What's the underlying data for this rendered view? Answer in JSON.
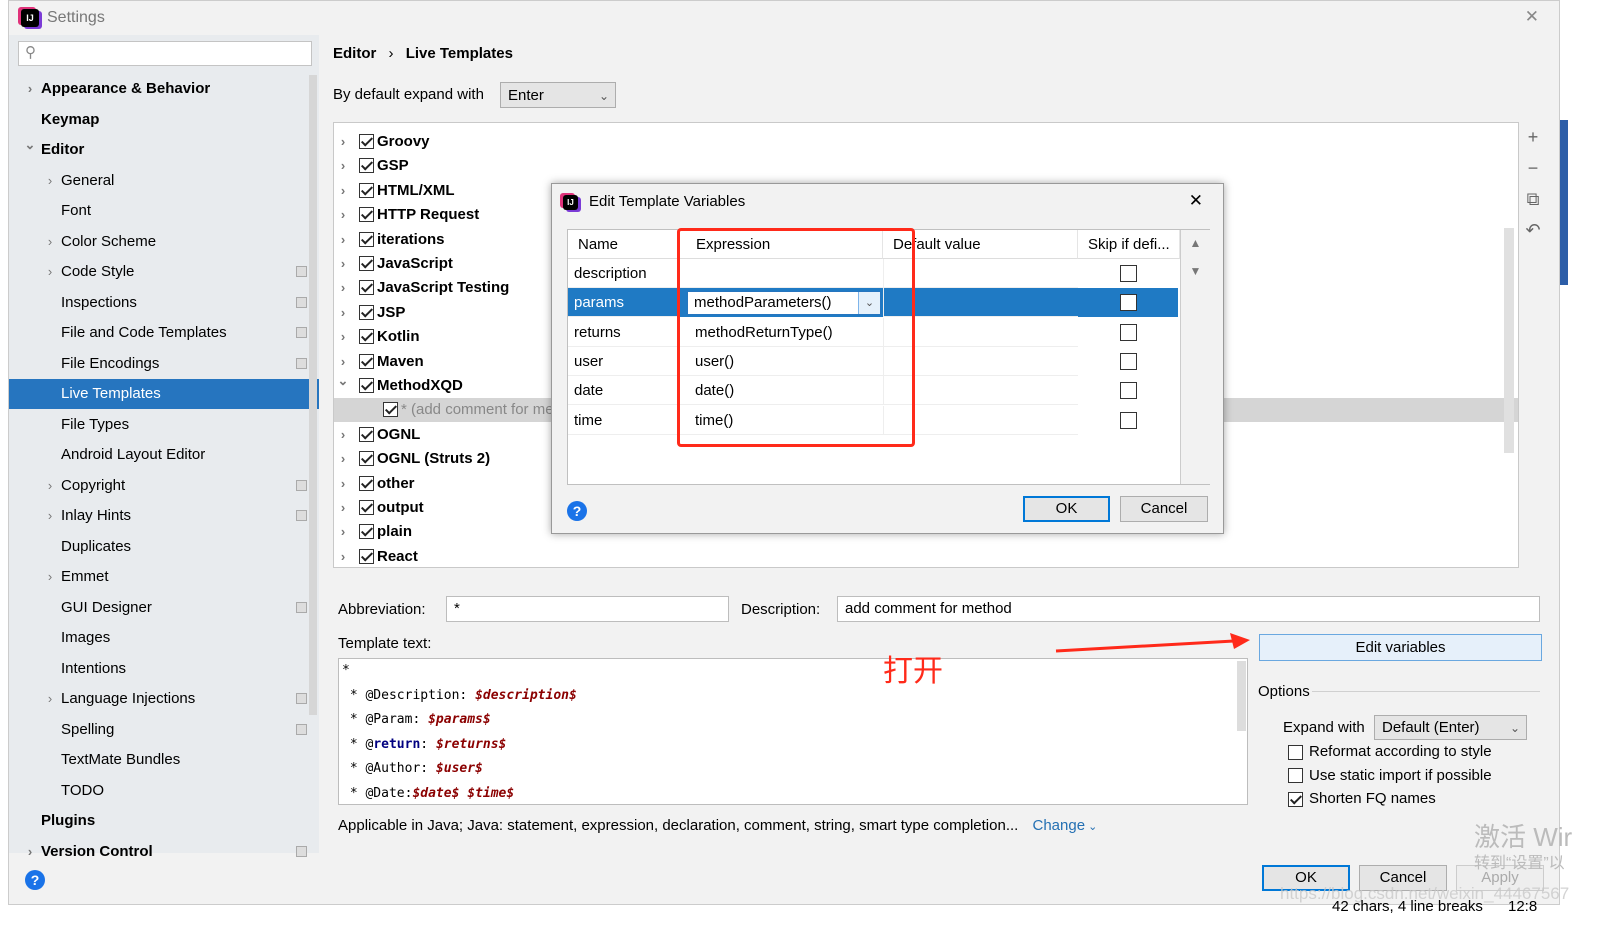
{
  "window": {
    "title": "Settings",
    "close": "✕"
  },
  "sidebar": {
    "search_placeholder": "",
    "items": [
      {
        "label": "Appearance & Behavior",
        "level": 0,
        "bold": true,
        "chevron": "right"
      },
      {
        "label": "Keymap",
        "level": 0,
        "bold": true
      },
      {
        "label": "Editor",
        "level": 0,
        "bold": true,
        "chevron": "down"
      },
      {
        "label": "General",
        "level": 1,
        "chevron": "right"
      },
      {
        "label": "Font",
        "level": 1
      },
      {
        "label": "Color Scheme",
        "level": 1,
        "chevron": "right"
      },
      {
        "label": "Code Style",
        "level": 1,
        "chevron": "right",
        "copy": true
      },
      {
        "label": "Inspections",
        "level": 1,
        "copy": true
      },
      {
        "label": "File and Code Templates",
        "level": 1,
        "copy": true
      },
      {
        "label": "File Encodings",
        "level": 1,
        "copy": true
      },
      {
        "label": "Live Templates",
        "level": 1,
        "selected": true
      },
      {
        "label": "File Types",
        "level": 1
      },
      {
        "label": "Android Layout Editor",
        "level": 1
      },
      {
        "label": "Copyright",
        "level": 1,
        "chevron": "right",
        "copy": true
      },
      {
        "label": "Inlay Hints",
        "level": 1,
        "chevron": "right",
        "copy": true
      },
      {
        "label": "Duplicates",
        "level": 1
      },
      {
        "label": "Emmet",
        "level": 1,
        "chevron": "right"
      },
      {
        "label": "GUI Designer",
        "level": 1,
        "copy": true
      },
      {
        "label": "Images",
        "level": 1
      },
      {
        "label": "Intentions",
        "level": 1
      },
      {
        "label": "Language Injections",
        "level": 1,
        "chevron": "right",
        "copy": true
      },
      {
        "label": "Spelling",
        "level": 1,
        "copy": true
      },
      {
        "label": "TextMate Bundles",
        "level": 1
      },
      {
        "label": "TODO",
        "level": 1
      },
      {
        "label": "Plugins",
        "level": 0,
        "bold": true
      },
      {
        "label": "Version Control",
        "level": 0,
        "bold": true,
        "chevron": "right",
        "copy": true
      }
    ]
  },
  "breadcrumb": {
    "parent": "Editor",
    "sep": "›",
    "current": "Live Templates"
  },
  "expand": {
    "label": "By default expand with",
    "value": "Enter"
  },
  "tree": [
    {
      "label": "Groovy",
      "checked": true
    },
    {
      "label": "GSP",
      "checked": true
    },
    {
      "label": "HTML/XML",
      "checked": true
    },
    {
      "label": "HTTP Request",
      "checked": true
    },
    {
      "label": "iterations",
      "checked": true
    },
    {
      "label": "JavaScript",
      "checked": true
    },
    {
      "label": "JavaScript Testing",
      "checked": true
    },
    {
      "label": "JSP",
      "checked": true
    },
    {
      "label": "Kotlin",
      "checked": true
    },
    {
      "label": "Maven",
      "checked": true
    },
    {
      "label": "MethodXQD",
      "checked": true,
      "expanded": true
    },
    {
      "label": "* (add comment for method)",
      "checked": true,
      "child": true
    },
    {
      "label": "OGNL",
      "checked": true
    },
    {
      "label": "OGNL (Struts 2)",
      "checked": true
    },
    {
      "label": "other",
      "checked": true
    },
    {
      "label": "output",
      "checked": true
    },
    {
      "label": "plain",
      "checked": true
    },
    {
      "label": "React",
      "checked": true
    }
  ],
  "toolbar": {
    "add": "+",
    "remove": "−",
    "copy": "⧉",
    "revert": "↶"
  },
  "abbreviation": {
    "label": "Abbreviation:",
    "value": "*"
  },
  "description": {
    "label": "Description:",
    "value": "add comment for method"
  },
  "template_text": {
    "label": "Template text:",
    "lines": [
      [
        {
          "t": "*"
        }
      ],
      [
        {
          "t": " * @Description: "
        },
        {
          "t": "$description$",
          "c": "var"
        }
      ],
      [
        {
          "t": " * @Param: "
        },
        {
          "t": "$params$",
          "c": "var"
        }
      ],
      [
        {
          "t": " * @"
        },
        {
          "t": "return",
          "c": "kw"
        },
        {
          "t": ": "
        },
        {
          "t": "$returns$",
          "c": "var"
        }
      ],
      [
        {
          "t": " * @Author: "
        },
        {
          "t": "$user$",
          "c": "var"
        }
      ],
      [
        {
          "t": " * @Date:"
        },
        {
          "t": "$date$",
          "c": "var"
        },
        {
          "t": " "
        },
        {
          "t": "$time$",
          "c": "var"
        }
      ]
    ]
  },
  "edit_variables": "Edit variables",
  "annotation": {
    "text": "打开",
    "color": "#ff2a1a"
  },
  "options": {
    "title": "Options",
    "expand_label": "Expand with",
    "expand_value": "Default (Enter)",
    "checks": [
      {
        "label": "Reformat according to style",
        "checked": false
      },
      {
        "label": "Use static import if possible",
        "checked": false
      },
      {
        "label": "Shorten FQ names",
        "checked": true
      }
    ]
  },
  "applicable": {
    "text": "Applicable in Java; Java: statement, expression, declaration, comment, string, smart type completion...",
    "change": "Change"
  },
  "footer": {
    "ok": "OK",
    "cancel": "Cancel",
    "apply": "Apply",
    "status": "42 chars, 4 line breaks",
    "pos": "12:8"
  },
  "watermark": {
    "activate": "激活 Wir",
    "goto": "转到“设置”以",
    "url": "https://blog.csdn.net/weixin_44467567"
  },
  "dialog": {
    "title": "Edit Template Variables",
    "close": "✕",
    "columns": [
      "Name",
      "Expression",
      "Default value",
      "Skip if defi..."
    ],
    "rows": [
      {
        "name": "description",
        "expression": "",
        "default": "",
        "skip": false
      },
      {
        "name": "params",
        "expression": "methodParameters()",
        "default": "",
        "skip": false,
        "selected": true
      },
      {
        "name": "returns",
        "expression": "methodReturnType()",
        "default": "",
        "skip": false
      },
      {
        "name": "user",
        "expression": "user()",
        "default": "",
        "skip": false
      },
      {
        "name": "date",
        "expression": "date()",
        "default": "",
        "skip": false
      },
      {
        "name": "time",
        "expression": "time()",
        "default": "",
        "skip": false
      }
    ],
    "ok": "OK",
    "cancel": "Cancel",
    "help": "?"
  },
  "colors": {
    "accent": "#2675bf",
    "highlight": "#ff2a1a"
  }
}
